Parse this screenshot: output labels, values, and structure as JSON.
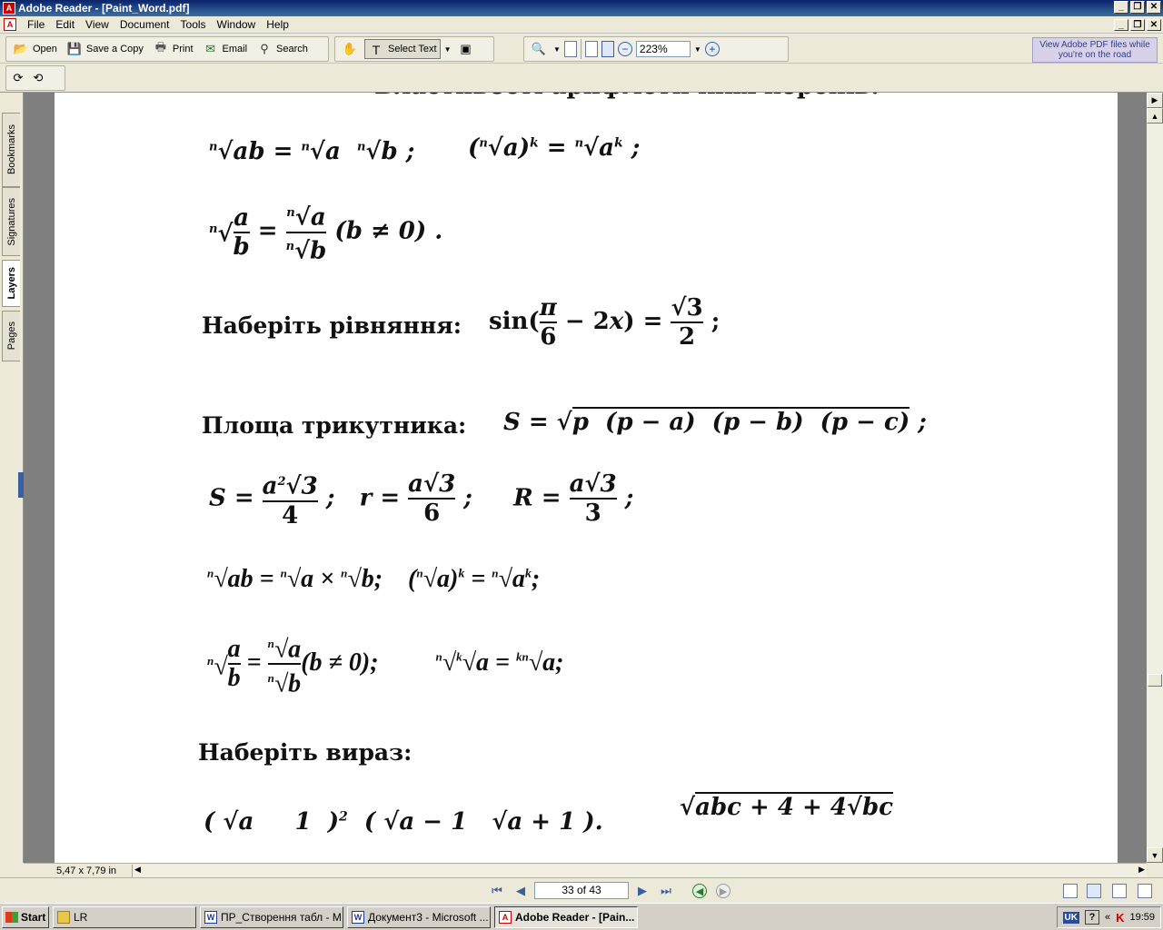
{
  "window": {
    "title": "Adobe Reader - [Paint_Word.pdf]"
  },
  "menu": {
    "items": [
      "File",
      "Edit",
      "View",
      "Document",
      "Tools",
      "Window",
      "Help"
    ]
  },
  "toolbar": {
    "open_label": "Open",
    "save_copy_label": "Save a Copy",
    "print_label": "Print",
    "email_label": "Email",
    "search_label": "Search",
    "select_text_label": "Select Text",
    "zoom_value": "223%"
  },
  "promo": {
    "line1": "View Adobe PDF files while",
    "line2": "you're on the road"
  },
  "nav_tabs": [
    "Bookmarks",
    "Signatures",
    "Layers",
    "Pages"
  ],
  "document": {
    "headings": {
      "equations": "Наберіть рівняння:",
      "triangle_area": "Площа трикутника:",
      "expression": "Наберіть вираз:"
    },
    "partial_top_line": "Властивості арифметичних коренів."
  },
  "status": {
    "page_size": "5,47 x 7,79 in"
  },
  "navigation": {
    "page_indicator": "33 of 43"
  },
  "taskbar": {
    "start_label": "Start",
    "tasks": [
      {
        "label": "LR",
        "icon": "folder-icon"
      },
      {
        "label": "ПР_Створення табл - M...",
        "icon": "word-icon"
      },
      {
        "label": "Документ3 - Microsoft ...",
        "icon": "word-icon"
      },
      {
        "label": "Adobe Reader - [Pain...",
        "icon": "pdf-icon"
      }
    ],
    "language": "UK",
    "clock": "19:59"
  }
}
